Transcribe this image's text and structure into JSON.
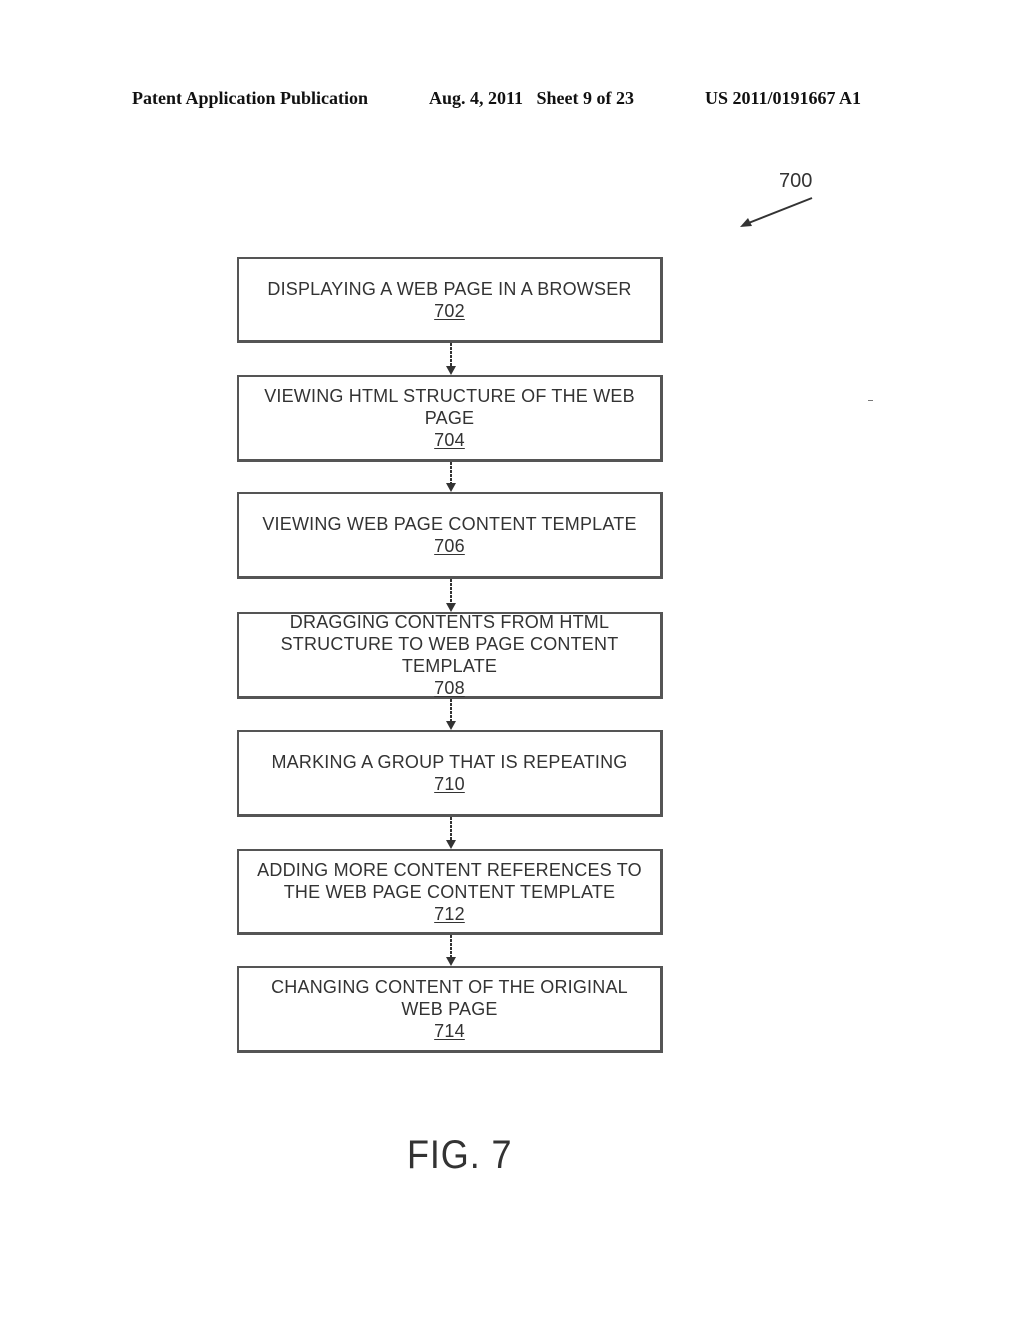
{
  "header": {
    "left": "Patent Application Publication",
    "middle": "Aug. 4, 2011   Sheet 9 of 23",
    "right": "US 2011/0191667 A1"
  },
  "figure_ref": "700",
  "steps": [
    {
      "label": "DISPLAYING A WEB PAGE IN A BROWSER",
      "num": "702"
    },
    {
      "label": "VIEWING HTML STRUCTURE OF THE WEB PAGE",
      "num": "704"
    },
    {
      "label": "VIEWING WEB PAGE CONTENT TEMPLATE",
      "num": "706"
    },
    {
      "label": "DRAGGING CONTENTS FROM HTML STRUCTURE TO WEB PAGE CONTENT TEMPLATE",
      "num": "708"
    },
    {
      "label": "MARKING A GROUP THAT IS REPEATING",
      "num": "710"
    },
    {
      "label": "ADDING MORE CONTENT REFERENCES TO THE WEB PAGE CONTENT TEMPLATE",
      "num": "712"
    },
    {
      "label": "CHANGING CONTENT OF THE ORIGINAL WEB PAGE",
      "num": "714"
    }
  ],
  "figure_caption": "FIG. 7"
}
